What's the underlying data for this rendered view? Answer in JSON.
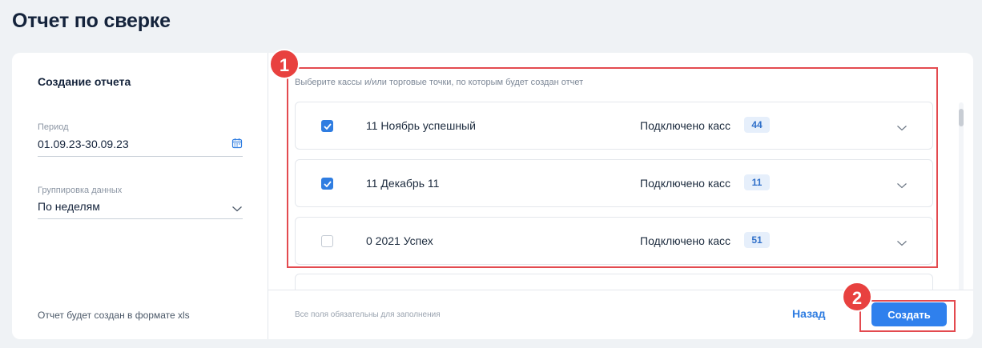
{
  "page": {
    "title": "Отчет по сверке"
  },
  "left": {
    "title": "Создание отчета",
    "period_label": "Период",
    "period_value": "01.09.23-30.09.23",
    "grouping_label": "Группировка данных",
    "grouping_value": "По неделям",
    "footer_note": "Отчет будет создан в формате xls"
  },
  "right": {
    "hint": "Выберите кассы и/или торговые точки, по которым будет создан отчет",
    "connected_label": "Подключено касс",
    "rows": [
      {
        "name": "11 Ноябрь успешный",
        "count": "44",
        "checked": true
      },
      {
        "name": "11 Декабрь 11",
        "count": "11",
        "checked": true
      },
      {
        "name": "0 2021 Успех",
        "count": "51",
        "checked": false
      }
    ]
  },
  "footer": {
    "note": "Все поля обязательны для заполнения",
    "back_label": "Назад",
    "create_label": "Создать"
  },
  "annotations": {
    "marker_1": "1",
    "marker_2": "2"
  },
  "colors": {
    "accent": "#2f80ed",
    "highlight": "#e34a4f",
    "badge_bg": "#e6effb"
  },
  "icons": {
    "period": "calendar-icon",
    "grouping": "chevron-down-icon",
    "row_expand": "chevron-down-icon"
  }
}
